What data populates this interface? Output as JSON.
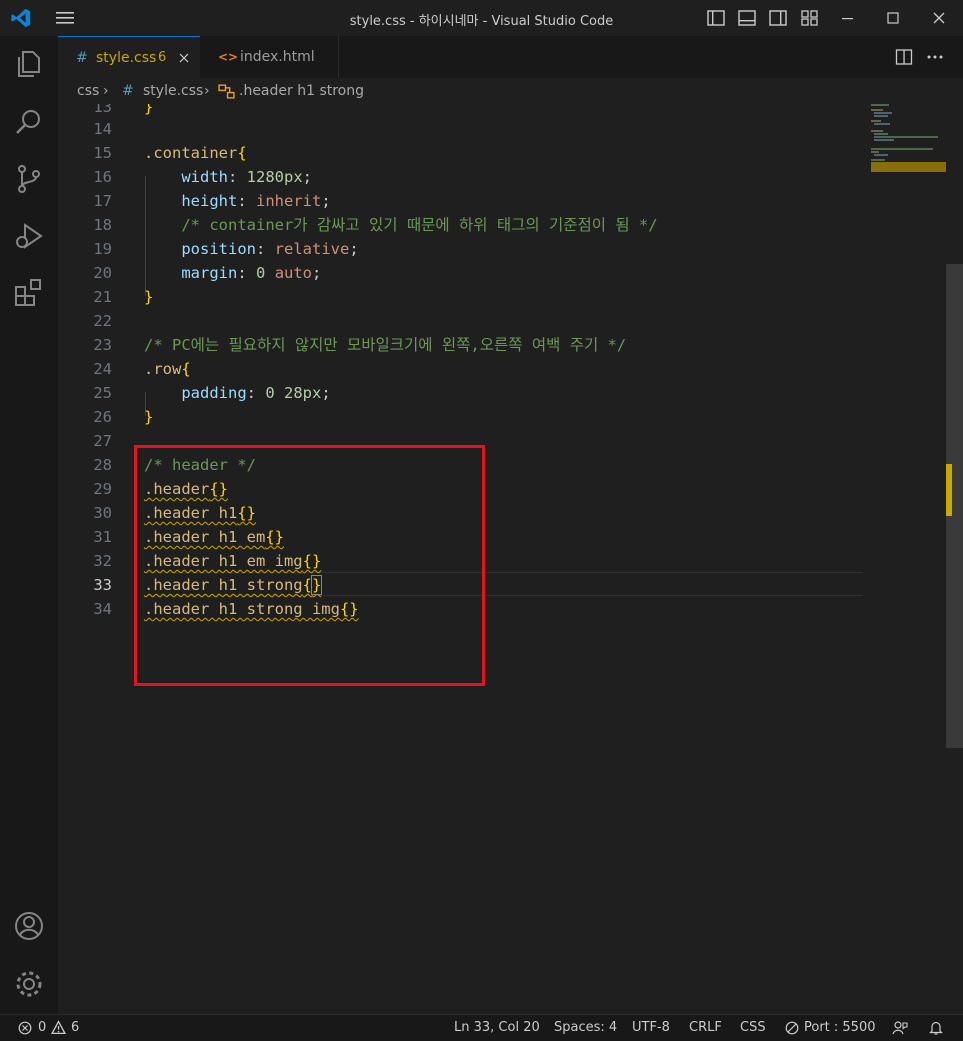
{
  "window": {
    "title": "style.css - 하이시네마 - Visual Studio Code"
  },
  "tabs": [
    {
      "label": "style.css",
      "badge": "6",
      "icon": "#"
    },
    {
      "label": "index.html",
      "icon": "<>"
    }
  ],
  "breadcrumb": {
    "folder": "css",
    "file": "style.css",
    "file_icon": "#",
    "symbol": ".header h1 strong"
  },
  "editor": {
    "top_line_number": "13",
    "top_line_text": "}",
    "lines": [
      {
        "n": "14"
      },
      {
        "n": "15"
      },
      {
        "n": "16"
      },
      {
        "n": "17"
      },
      {
        "n": "18"
      },
      {
        "n": "19"
      },
      {
        "n": "20"
      },
      {
        "n": "21"
      },
      {
        "n": "22"
      },
      {
        "n": "23"
      },
      {
        "n": "24"
      },
      {
        "n": "25"
      },
      {
        "n": "26"
      },
      {
        "n": "27"
      },
      {
        "n": "28"
      },
      {
        "n": "29"
      },
      {
        "n": "30"
      },
      {
        "n": "31"
      },
      {
        "n": "32"
      },
      {
        "n": "33"
      },
      {
        "n": "34"
      }
    ],
    "code": {
      "l15_sel": ".container",
      "l16_prop": "width",
      "l16_val": "1280px",
      "l17_prop": "height",
      "l17_val": "inherit",
      "l18_comment": "/* container가 감싸고 있기 때문에 하위 태그의 기준점이 됨 */",
      "l19_prop": "position",
      "l19_val": "relative",
      "l20_prop": "margin",
      "l20_val1": "0",
      "l20_val2": "auto",
      "l23_comment": "/* PC에는 필요하지 않지만 모바일크기에 왼쪽,오른쪽 여백 주기 */",
      "l24_sel": ".row",
      "l25_prop": "padding",
      "l25_val1": "0",
      "l25_val2": "28px",
      "l28_comment": "/* header */",
      "l29_sel": ".header",
      "l30_sel": ".header h1",
      "l31_sel": ".header h1 em",
      "l32_sel": ".header h1 em img",
      "l33_sel": ".header h1 strong",
      "l34_sel": ".header h1 strong img"
    }
  },
  "statusbar": {
    "errors": "0",
    "warnings": "6",
    "position": "Ln 33, Col 20",
    "spaces": "Spaces: 4",
    "encoding": "UTF-8",
    "eol": "CRLF",
    "language": "CSS",
    "port": "Port : 5500"
  },
  "colors": {
    "accent": "#0078d4",
    "highlight_box": "#e81123",
    "warning": "#cca700"
  }
}
